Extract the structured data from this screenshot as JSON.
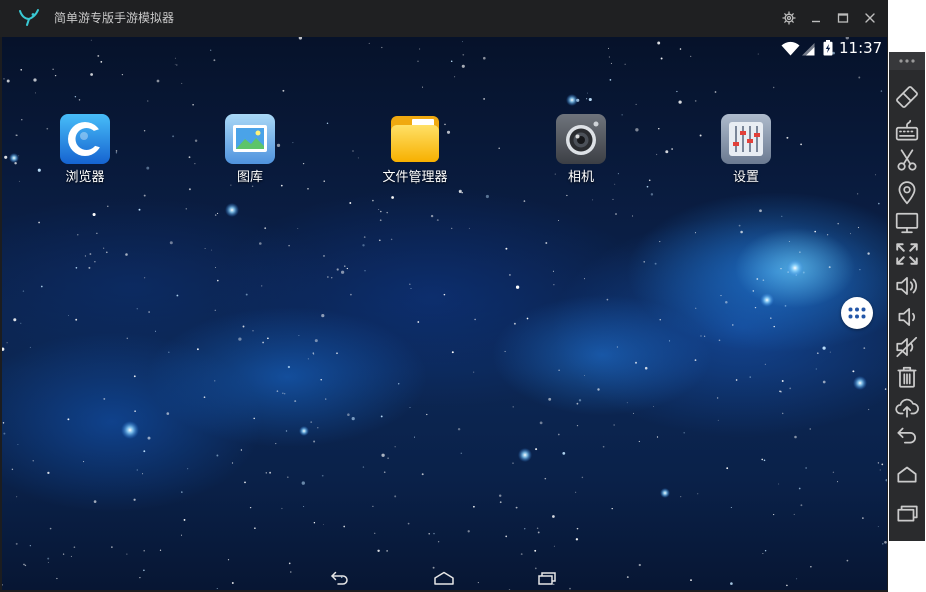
{
  "window": {
    "title": "简单游专版手游模拟器",
    "logo_icon": "sprout-logo-icon",
    "controls": [
      "settings-gear-icon",
      "minimize-icon",
      "maximize-icon",
      "close-icon"
    ]
  },
  "status_bar": {
    "time": "11:37",
    "icons": [
      "wifi-icon",
      "signal-icon",
      "battery-charging-icon"
    ]
  },
  "desktop": {
    "apps": [
      {
        "label": "浏览器",
        "icon": "browser-icon"
      },
      {
        "label": "图库",
        "icon": "gallery-icon"
      },
      {
        "label": "文件管理器",
        "icon": "file-manager-icon"
      },
      {
        "label": "相机",
        "icon": "camera-icon"
      },
      {
        "label": "设置",
        "icon": "settings-icon"
      }
    ]
  },
  "app_drawer": {
    "icon": "app-drawer-icon"
  },
  "nav_bar": {
    "icons": [
      "back-icon",
      "home-icon",
      "recents-icon"
    ]
  },
  "side_toolbar": {
    "items": [
      "more-icon",
      "rotate-screen-icon",
      "keyboard-icon",
      "scissors-icon",
      "location-icon",
      "display-icon",
      "fullscreen-icon",
      "volume-up-icon",
      "volume-down-icon",
      "mute-icon",
      "trash-icon",
      "cloud-upload-icon",
      "back-icon",
      "home-icon",
      "recents-icon"
    ]
  },
  "colors": {
    "title_bar": "#1f2022",
    "side_toolbar": "#2a2b2d",
    "logo_accent": "#39c9d4",
    "drawer_dots": "#2356a8",
    "wallpaper": "#0a1e44"
  }
}
